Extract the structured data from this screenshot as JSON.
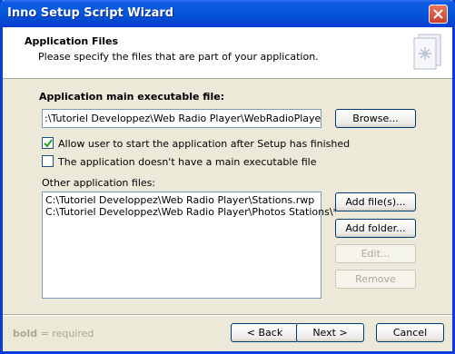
{
  "window": {
    "title": "Inno Setup Script Wizard"
  },
  "header": {
    "title": "Application Files",
    "subtitle": "Please specify the files that are part of your application."
  },
  "main_exe": {
    "label": "Application main executable file:",
    "value": ":\\Tutoriel Developpez\\Web Radio Player\\WebRadioPlayer.exe",
    "browse_label": "Browse..."
  },
  "options": [
    {
      "label": "Allow user to start the application after Setup has finished",
      "checked": true
    },
    {
      "label": "The application doesn't have a main executable file",
      "checked": false
    }
  ],
  "other_files": {
    "label": "Other application files:",
    "items": [
      "C:\\Tutoriel Developpez\\Web Radio Player\\Stations.rwp",
      "C:\\Tutoriel Developpez\\Web Radio Player\\Photos Stations\\*"
    ],
    "add_files_label": "Add file(s)...",
    "add_folder_label": "Add folder...",
    "edit_label": "Edit...",
    "remove_label": "Remove"
  },
  "footer": {
    "note_bold": "bold",
    "note_rest": " = required",
    "back_label": "< Back",
    "next_label": "Next >",
    "cancel_label": "Cancel"
  },
  "colors": {
    "titlebar": "#0558d8",
    "accent": "#003c74",
    "dialog_bg": "#ece9d8"
  }
}
